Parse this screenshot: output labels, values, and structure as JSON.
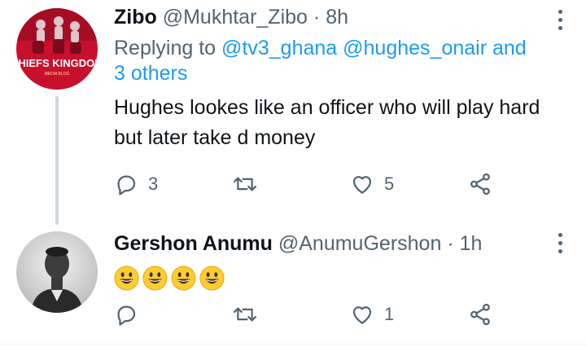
{
  "tweets": [
    {
      "avatar_text": "CHIEFS KINGDOM",
      "avatar_subtext": "MEDIA BLOG",
      "display_name": "Zibo",
      "handle": "@Mukhtar_Zibo",
      "dot": "·",
      "time": "8h",
      "replying_prefix": "Replying to",
      "replying_users": [
        "@tv3_ghana",
        "@hughes_onair"
      ],
      "replying_and": "and",
      "replying_others": "3 others",
      "text": "Hughes lookes like an officer who will play hard but later take d money",
      "reply_count": "3",
      "retweet_count": "",
      "like_count": "5"
    },
    {
      "display_name": "Gershon Anumu",
      "handle": "@AnumuGershon",
      "dot": "·",
      "time": "1h",
      "emojis": [
        "grinning-face",
        "grinning-face",
        "grinning-face",
        "grinning-face"
      ],
      "reply_count": "",
      "retweet_count": "",
      "like_count": "1"
    }
  ],
  "icons": {
    "reply": "reply-icon",
    "retweet": "retweet-icon",
    "like": "heart-icon",
    "share": "share-icon",
    "more": "more-options-icon"
  },
  "colors": {
    "text": "#0f1419",
    "secondary": "#536471",
    "link": "#1d9bf0",
    "thread_line": "#cfd9de",
    "avatar_red": "#c8102e"
  }
}
